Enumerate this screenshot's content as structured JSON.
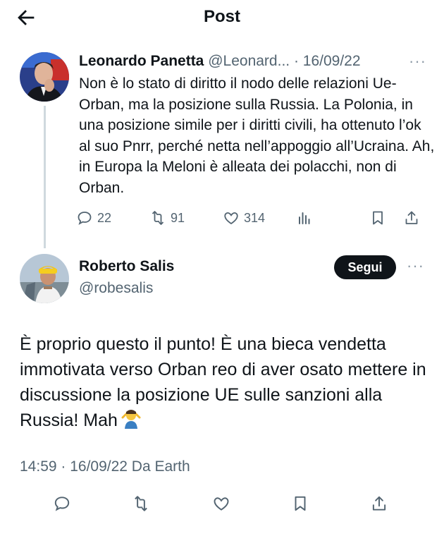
{
  "header": {
    "title": "Post"
  },
  "original_post": {
    "author_name": "Leonardo Panetta",
    "handle": "@Leonard...",
    "separator": "·",
    "date": "16/09/22",
    "more": "···",
    "text": "Non è lo stato di diritto il nodo delle relazioni Ue-Orban, ma la posizione sulla Russia. La Polonia, in una posizione simile per i diritti civili, ha ottenuto l’ok al suo Pnrr, perché netta nell’appoggio all’Ucraina. Ah, in Europa la Meloni è alleata dei polacchi, non di Orban.",
    "replies": "22",
    "reposts": "91",
    "likes": "314"
  },
  "reply_post": {
    "author_name": "Roberto Salis",
    "handle": "@robesalis",
    "follow_label": "Segui",
    "more": "···",
    "text": "È proprio questo il punto! È una bieca vendetta immotivata verso Orban reo di aver osato mettere in discussione la posizione UE sulle sanzioni alla Russia! Mah",
    "meta": "14:59 · 16/09/22 Da Earth"
  },
  "icons": [
    "back-arrow-icon",
    "reply-icon",
    "repost-icon",
    "like-icon",
    "views-icon",
    "bookmark-icon",
    "share-icon",
    "shrug-emoji-icon"
  ],
  "colors": {
    "text": "#0f1419",
    "muted": "#536471",
    "follow_bg": "#0f1419",
    "thread_line": "#cfd9de"
  }
}
